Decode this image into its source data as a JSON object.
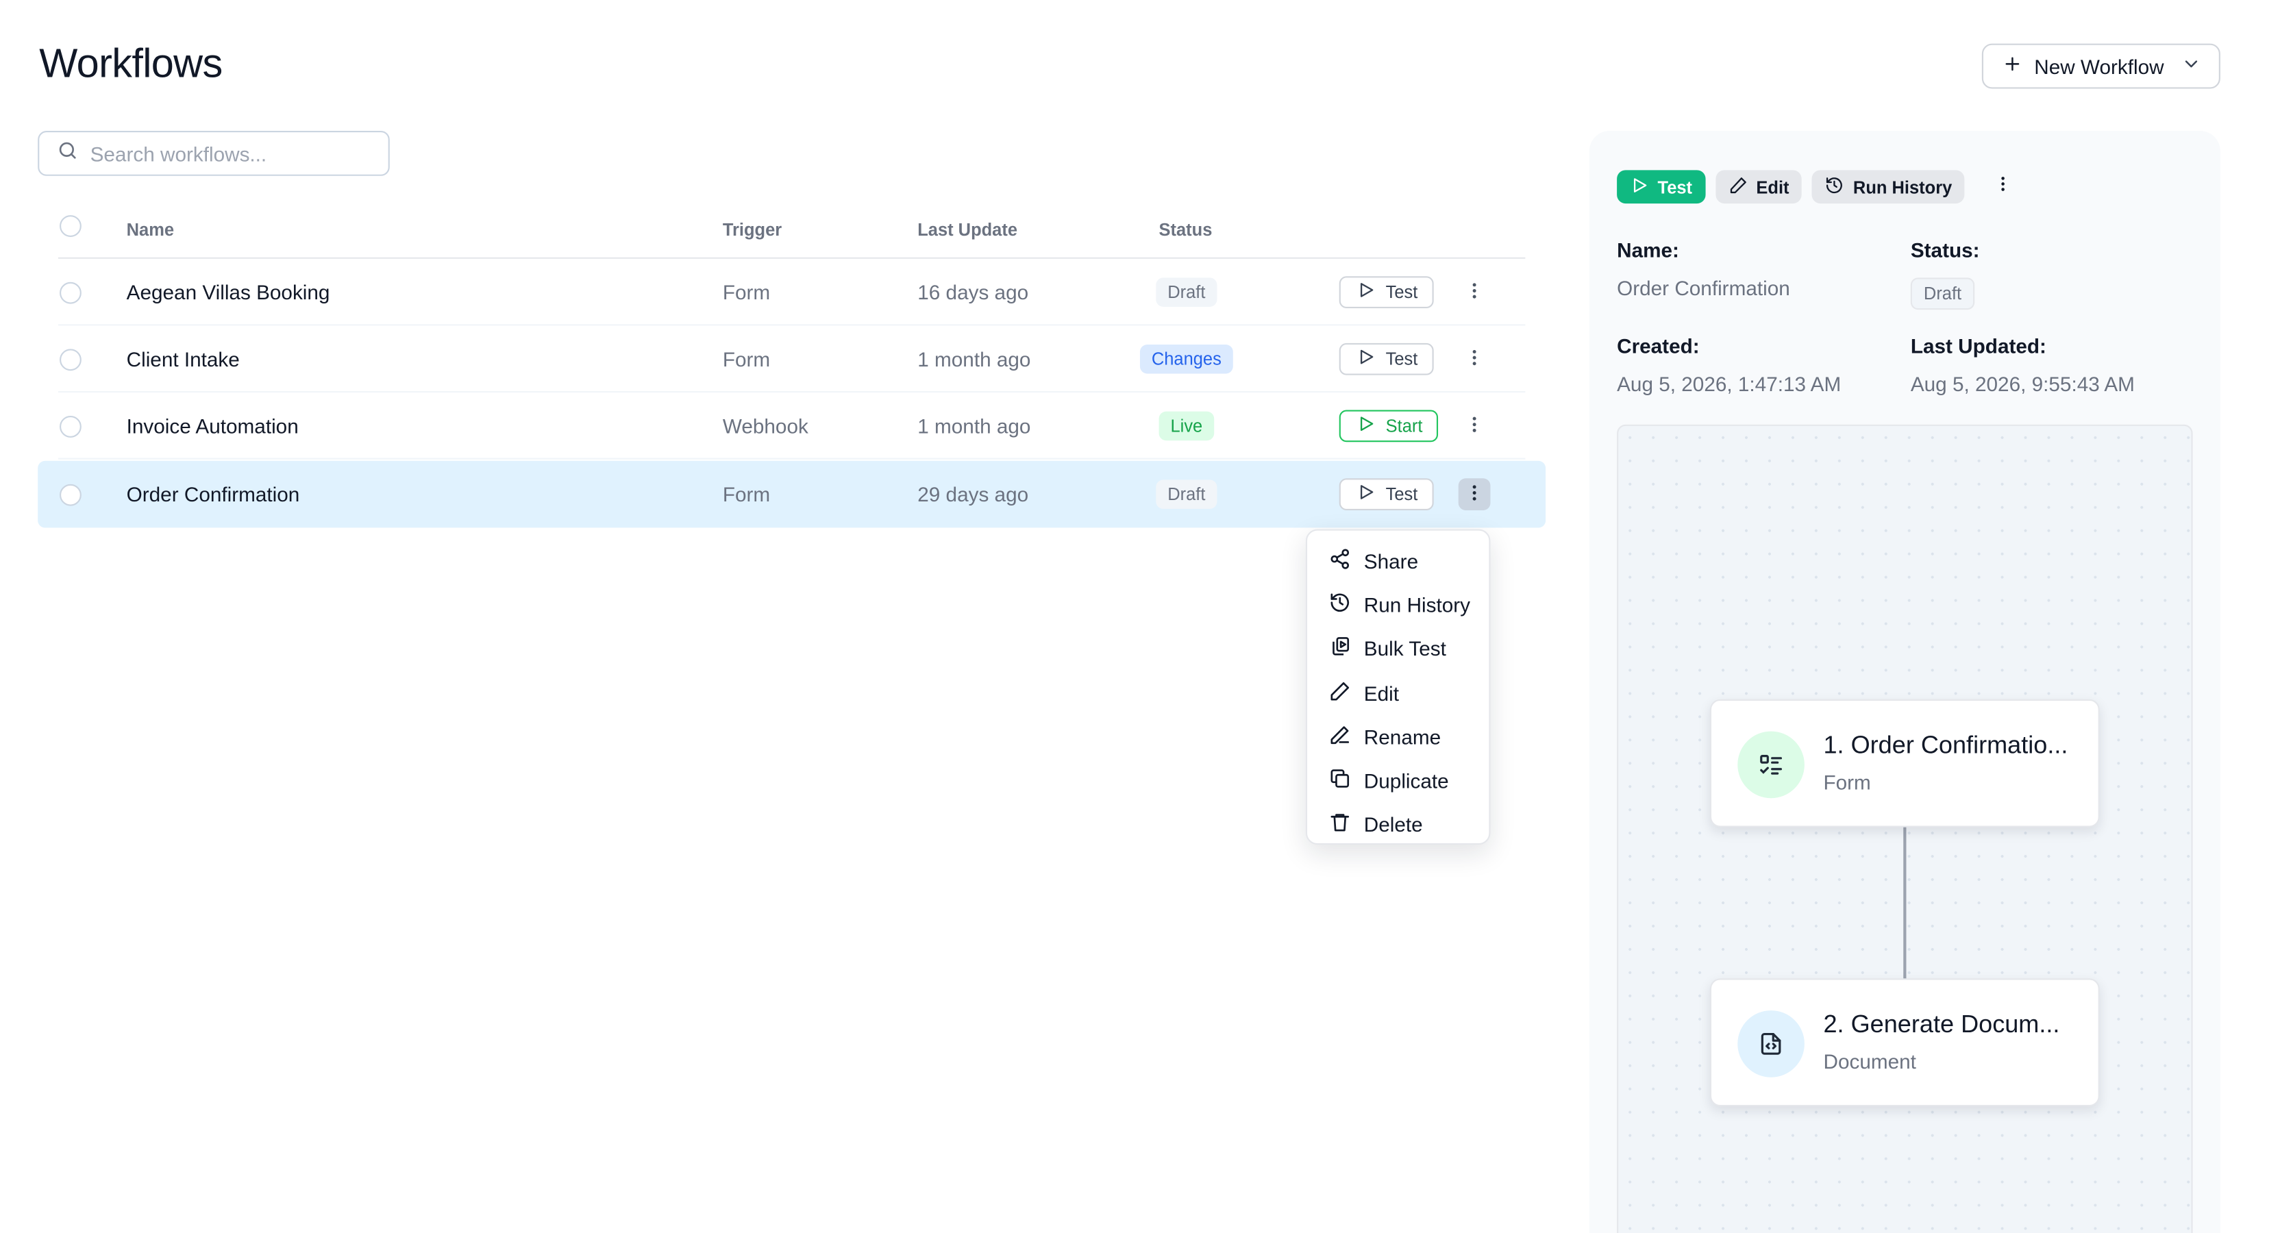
{
  "page": {
    "title": "Workflows"
  },
  "header": {
    "new_button_label": "New Workflow"
  },
  "search": {
    "placeholder": "Search workflows..."
  },
  "table": {
    "columns": {
      "name": "Name",
      "trigger": "Trigger",
      "last_update": "Last Update",
      "status": "Status"
    },
    "rows": [
      {
        "name": "Aegean Villas Booking",
        "trigger": "Form",
        "last_update": "16 days ago",
        "status": "Draft",
        "action": "Test"
      },
      {
        "name": "Client Intake",
        "trigger": "Form",
        "last_update": "1 month ago",
        "status": "Changes",
        "action": "Test"
      },
      {
        "name": "Invoice Automation",
        "trigger": "Webhook",
        "last_update": "1 month ago",
        "status": "Live",
        "action": "Start"
      },
      {
        "name": "Order Confirmation",
        "trigger": "Form",
        "last_update": "29 days ago",
        "status": "Draft",
        "action": "Test"
      }
    ]
  },
  "context_menu": {
    "items": [
      "Share",
      "Run History",
      "Bulk Test",
      "Edit",
      "Rename",
      "Duplicate",
      "Delete"
    ]
  },
  "details": {
    "toolbar": {
      "test": "Test",
      "edit": "Edit",
      "run_history": "Run History"
    },
    "name_label": "Name:",
    "name_value": "Order Confirmation",
    "status_label": "Status:",
    "status_value": "Draft",
    "created_label": "Created:",
    "created_value": "Aug 5, 2026, 1:47:13 AM",
    "updated_label": "Last Updated:",
    "updated_value": "Aug 5, 2026, 9:55:43 AM",
    "nodes": [
      {
        "title": "1. Order Confirmatio...",
        "subtitle": "Form"
      },
      {
        "title": "2. Generate Docum...",
        "subtitle": "Document"
      }
    ]
  },
  "colors": {
    "primary": "#10b981",
    "selected_row": "#e0f2fe",
    "draft_badge": "#f1f5f9",
    "changes_badge": "#dbeafe",
    "live_badge": "#dcfce7"
  }
}
